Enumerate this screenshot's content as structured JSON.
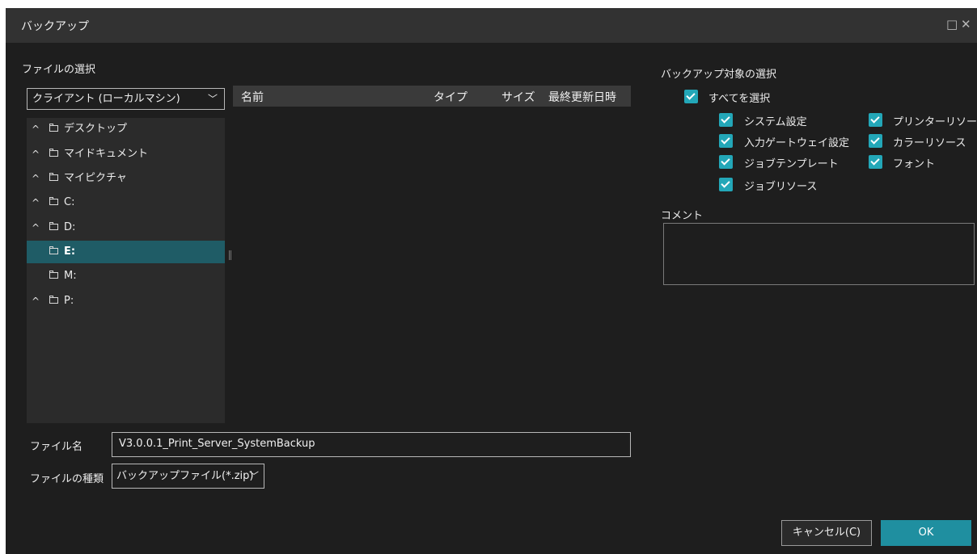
{
  "window": {
    "title": "バックアップ",
    "maximize_glyph": "□",
    "close_glyph": "✕"
  },
  "file_selection": {
    "heading": "ファイルの選択",
    "location_select": "クライアント (ローカルマシン)",
    "tree": [
      {
        "label": "デスクトップ",
        "expander": "^",
        "selected": false
      },
      {
        "label": "マイドキュメント",
        "expander": "^",
        "selected": false
      },
      {
        "label": "マイピクチャ",
        "expander": "^",
        "selected": false
      },
      {
        "label": "C:",
        "expander": "^",
        "selected": false
      },
      {
        "label": "D:",
        "expander": "^",
        "selected": false
      },
      {
        "label": "E:",
        "expander": "",
        "selected": true
      },
      {
        "label": "M:",
        "expander": "",
        "selected": false
      },
      {
        "label": "P:",
        "expander": "^",
        "selected": false
      }
    ],
    "columns": {
      "name": "名前",
      "type": "タイプ",
      "size": "サイズ",
      "modified": "最終更新日時"
    }
  },
  "backup_targets": {
    "heading": "バックアップ対象の選択",
    "select_all": {
      "label": "すべてを選択",
      "checked": true
    },
    "items": [
      {
        "label": "システム設定",
        "checked": true
      },
      {
        "label": "プリンターリソース",
        "checked": true
      },
      {
        "label": "入力ゲートウェイ設定",
        "checked": true
      },
      {
        "label": "カラーリソース",
        "checked": true
      },
      {
        "label": "ジョブテンプレート",
        "checked": true
      },
      {
        "label": "フォント",
        "checked": true
      },
      {
        "label": "ジョブリソース",
        "checked": true
      }
    ],
    "check_color": "#23a7b8"
  },
  "comment": {
    "label": "コメント",
    "value": ""
  },
  "filename": {
    "label": "ファイル名",
    "value": "V3.0.0.1_Print_Server_SystemBackup"
  },
  "filetype": {
    "label": "ファイルの種類",
    "value": "バックアップファイル(*.zip)"
  },
  "buttons": {
    "cancel": "キャンセル(C)",
    "ok": "OK"
  },
  "colors": {
    "accent": "#1f8fa0",
    "selection": "#1f5c66",
    "background": "#1e1e1e"
  }
}
